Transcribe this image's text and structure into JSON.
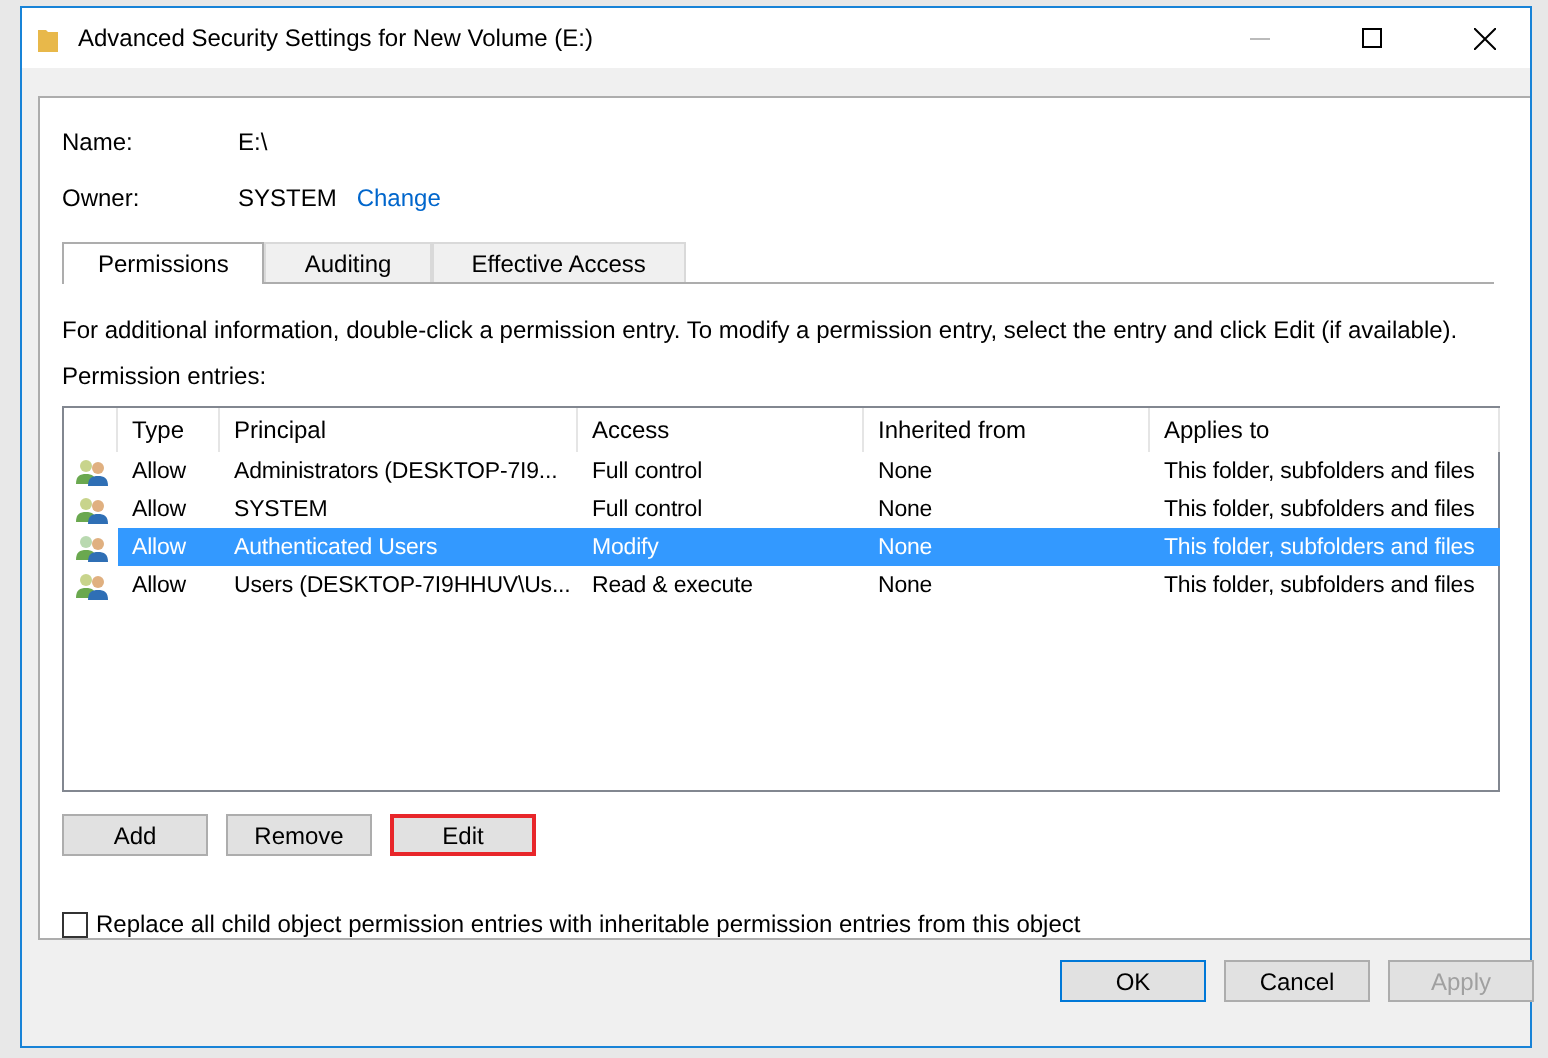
{
  "window": {
    "title": "Advanced Security Settings for New Volume (E:)"
  },
  "name": {
    "label": "Name:",
    "value": "E:\\"
  },
  "owner": {
    "label": "Owner:",
    "value": "SYSTEM",
    "link": "Change"
  },
  "tabs": [
    {
      "label": "Permissions",
      "selected": true
    },
    {
      "label": "Auditing",
      "selected": false
    },
    {
      "label": "Effective Access",
      "selected": false
    }
  ],
  "info": "For additional information, double-click a permission entry. To modify a permission entry, select the entry and click Edit (if available).",
  "entries_label": "Permission entries:",
  "table": {
    "columns": [
      "Type",
      "Principal",
      "Access",
      "Inherited from",
      "Applies to"
    ],
    "rows": [
      {
        "cells": [
          "Allow",
          "Administrators (DESKTOP-7I9...",
          "Full control",
          "None",
          "This folder, subfolders and files"
        ],
        "selected": false
      },
      {
        "cells": [
          "Allow",
          "SYSTEM",
          "Full control",
          "None",
          "This folder, subfolders and files"
        ],
        "selected": false
      },
      {
        "cells": [
          "Allow",
          "Authenticated Users",
          "Modify",
          "None",
          "This folder, subfolders and files"
        ],
        "selected": true
      },
      {
        "cells": [
          "Allow",
          "Users (DESKTOP-7I9HHUV\\Us...",
          "Read & execute",
          "None",
          "This folder, subfolders and files"
        ],
        "selected": false
      }
    ]
  },
  "entry_buttons": [
    {
      "label": "Add",
      "highlighted": false
    },
    {
      "label": "Remove",
      "highlighted": false
    },
    {
      "label": "Edit",
      "highlighted": true
    }
  ],
  "replace_option": {
    "label": "Replace all child object permission entries with inheritable permission entries from this object",
    "checked": false
  },
  "buttons": [
    {
      "label": "OK",
      "default": true,
      "disabled": false
    },
    {
      "label": "Cancel",
      "default": false,
      "disabled": false
    },
    {
      "label": "Apply",
      "default": false,
      "disabled": true
    }
  ]
}
